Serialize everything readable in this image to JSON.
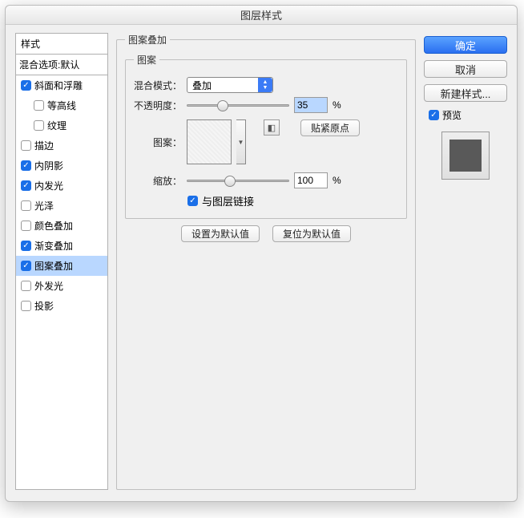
{
  "title": "图层样式",
  "left": {
    "header": "样式",
    "sub": "混合选项:默认",
    "items": [
      {
        "label": "斜面和浮雕",
        "checked": true,
        "indent": false
      },
      {
        "label": "等高线",
        "checked": false,
        "indent": true
      },
      {
        "label": "纹理",
        "checked": false,
        "indent": true
      },
      {
        "label": "描边",
        "checked": false,
        "indent": false
      },
      {
        "label": "内阴影",
        "checked": true,
        "indent": false
      },
      {
        "label": "内发光",
        "checked": true,
        "indent": false
      },
      {
        "label": "光泽",
        "checked": false,
        "indent": false
      },
      {
        "label": "颜色叠加",
        "checked": false,
        "indent": false
      },
      {
        "label": "渐变叠加",
        "checked": true,
        "indent": false
      },
      {
        "label": "图案叠加",
        "checked": true,
        "indent": false,
        "selected": true
      },
      {
        "label": "外发光",
        "checked": false,
        "indent": false
      },
      {
        "label": "投影",
        "checked": false,
        "indent": false
      }
    ]
  },
  "center": {
    "outer_legend": "图案叠加",
    "inner_legend": "图案",
    "blend_label": "混合模式：",
    "blend_value": "叠加",
    "opacity_label": "不透明度：",
    "opacity_value": "35",
    "opacity_pct": 35,
    "pattern_label": "图案：",
    "snap_label": "贴紧原点",
    "scale_label": "缩放：",
    "scale_value": "100",
    "scale_pct": 100,
    "link_label": "与图层链接",
    "set_default": "设置为默认值",
    "reset_default": "复位为默认值",
    "percent": "%"
  },
  "right": {
    "ok": "确定",
    "cancel": "取消",
    "new_style": "新建样式...",
    "preview": "预览"
  }
}
